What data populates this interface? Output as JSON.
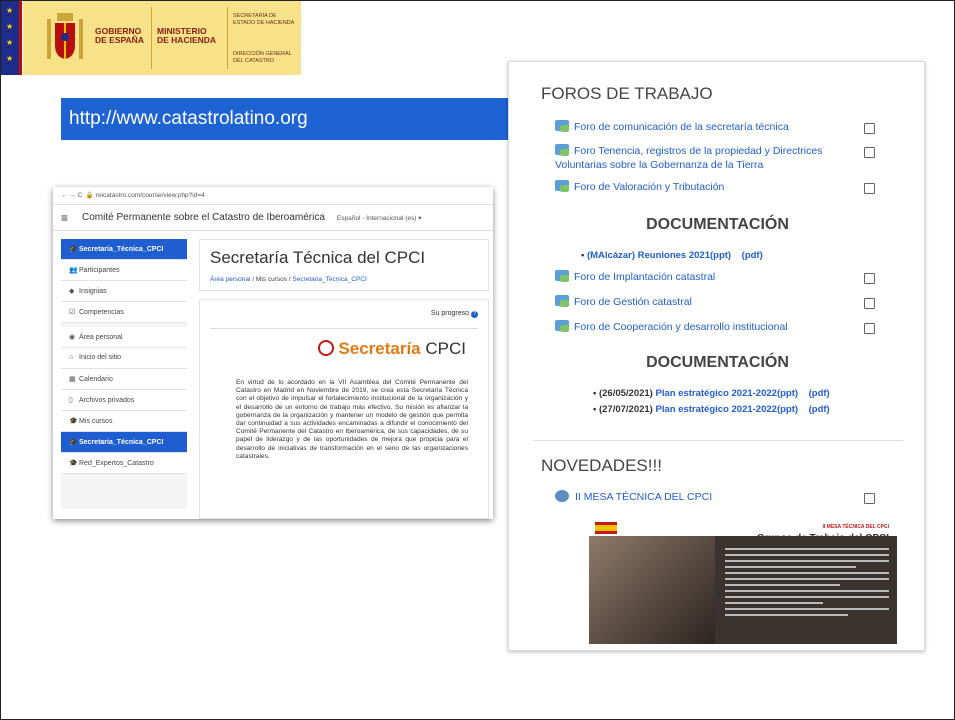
{
  "header": {
    "gov_line1": "GOBIERNO",
    "gov_line2": "DE ESPAÑA",
    "ministry_line1": "MINISTERIO",
    "ministry_line2": "DE HACIENDA",
    "secretaria": "SECRETARÍA DE ESTADO DE HACIENDA",
    "direccion": "DIRECCIÓN GENERAL DEL CATASTRO"
  },
  "url_banner": "http://www.catastrolatino.org",
  "screenshot": {
    "address": "reicatastro.com/course/view.php?id=4",
    "site_title": "Comité Permanente sobre el Catastro de Iberoamérica",
    "language": "Español - Internacional (es) ▾",
    "sidebar": [
      {
        "label": "Secretaria_Técnica_CPCI",
        "icon": "graduation-cap-icon",
        "active": true
      },
      {
        "label": "Participantes",
        "icon": "users-icon"
      },
      {
        "label": "Insignias",
        "icon": "shield-icon"
      },
      {
        "label": "Competencias",
        "icon": "checkbox-icon"
      },
      {
        "label": "Área personal",
        "icon": "dashboard-icon"
      },
      {
        "label": "Inicio del sitio",
        "icon": "home-icon"
      },
      {
        "label": "Calendario",
        "icon": "calendar-icon"
      },
      {
        "label": "Archivos privados",
        "icon": "file-icon"
      },
      {
        "label": "Mis cursos",
        "icon": "graduation-cap-icon"
      },
      {
        "label": "Secretaria_Técnica_CPCI",
        "icon": "graduation-cap-icon",
        "active": true
      },
      {
        "label": "Red_Expertos_Catastro",
        "icon": "graduation-cap-icon"
      }
    ],
    "course_title": "Secretaría Técnica del CPCI",
    "breadcrumb": [
      "Área personal",
      "Mis cursos",
      "Secretaria_Tecnica_CPCI"
    ],
    "progress_label": "Su progreso",
    "brand_orange": "Secretaría",
    "brand_plain": "CPCI",
    "paragraph": "En virtud de lo acordado en la VII Asamblea del Comité Permanente del Catastro en Madrid en Noviembre de 2019, se crea esta Secretaría Técnica con el objetivo de impulsar el fortalecimiento institucional de la organización y el desarrollo de un entorno de trabajo más efectivo. Su misión es afianzar la gobernanza de la organización y mantener un modelo de gestión que permita dar continuidad a sus actividades encaminadas a difundir el conocimiento del Comité Permanente del Catastro en Iberoamérica, de sus capacidades, de su papel de liderazgo y de las oportunidades de mejora que propicia para el desarrollo de iniciativas de transformación en el seno de las organizaciones catastrales."
  },
  "panel": {
    "foros_title": "FOROS DE TRABAJO",
    "foros1": [
      "Foro de comunicación de la secretaría técnica",
      "Foro Tenencia, registros de la propiedad y Directrices Voluntarias sobre la Gobernanza de la Tierra",
      "Foro de Valoración y Tributación"
    ],
    "doc_title": "DOCUMENTACIÓN",
    "doc1": {
      "prefix": "(MAlcázar) Reuniones 2021(ppt)",
      "pdf": "(pdf)"
    },
    "foros2": [
      "Foro de Implantación catastral",
      "Foro de Gestión catastral",
      "Foro de Cooperación y desarrollo institucional"
    ],
    "doc2": [
      {
        "date": "(26/05/2021)",
        "link": "Plan estratégico 2021-2022(ppt)",
        "pdf": "(pdf)"
      },
      {
        "date": "(27/07/2021)",
        "link": "Plan estratégico 2021-2022(ppt)",
        "pdf": "(pdf)"
      }
    ],
    "news_title": "NOVEDADES!!!",
    "news_item": "II MESA TÉCNICA DEL CPCI",
    "news_image_title1": "II MESA TÉCNICA DEL CPCI",
    "news_image_title2": "Grupos de Trabajo del CPCI"
  }
}
